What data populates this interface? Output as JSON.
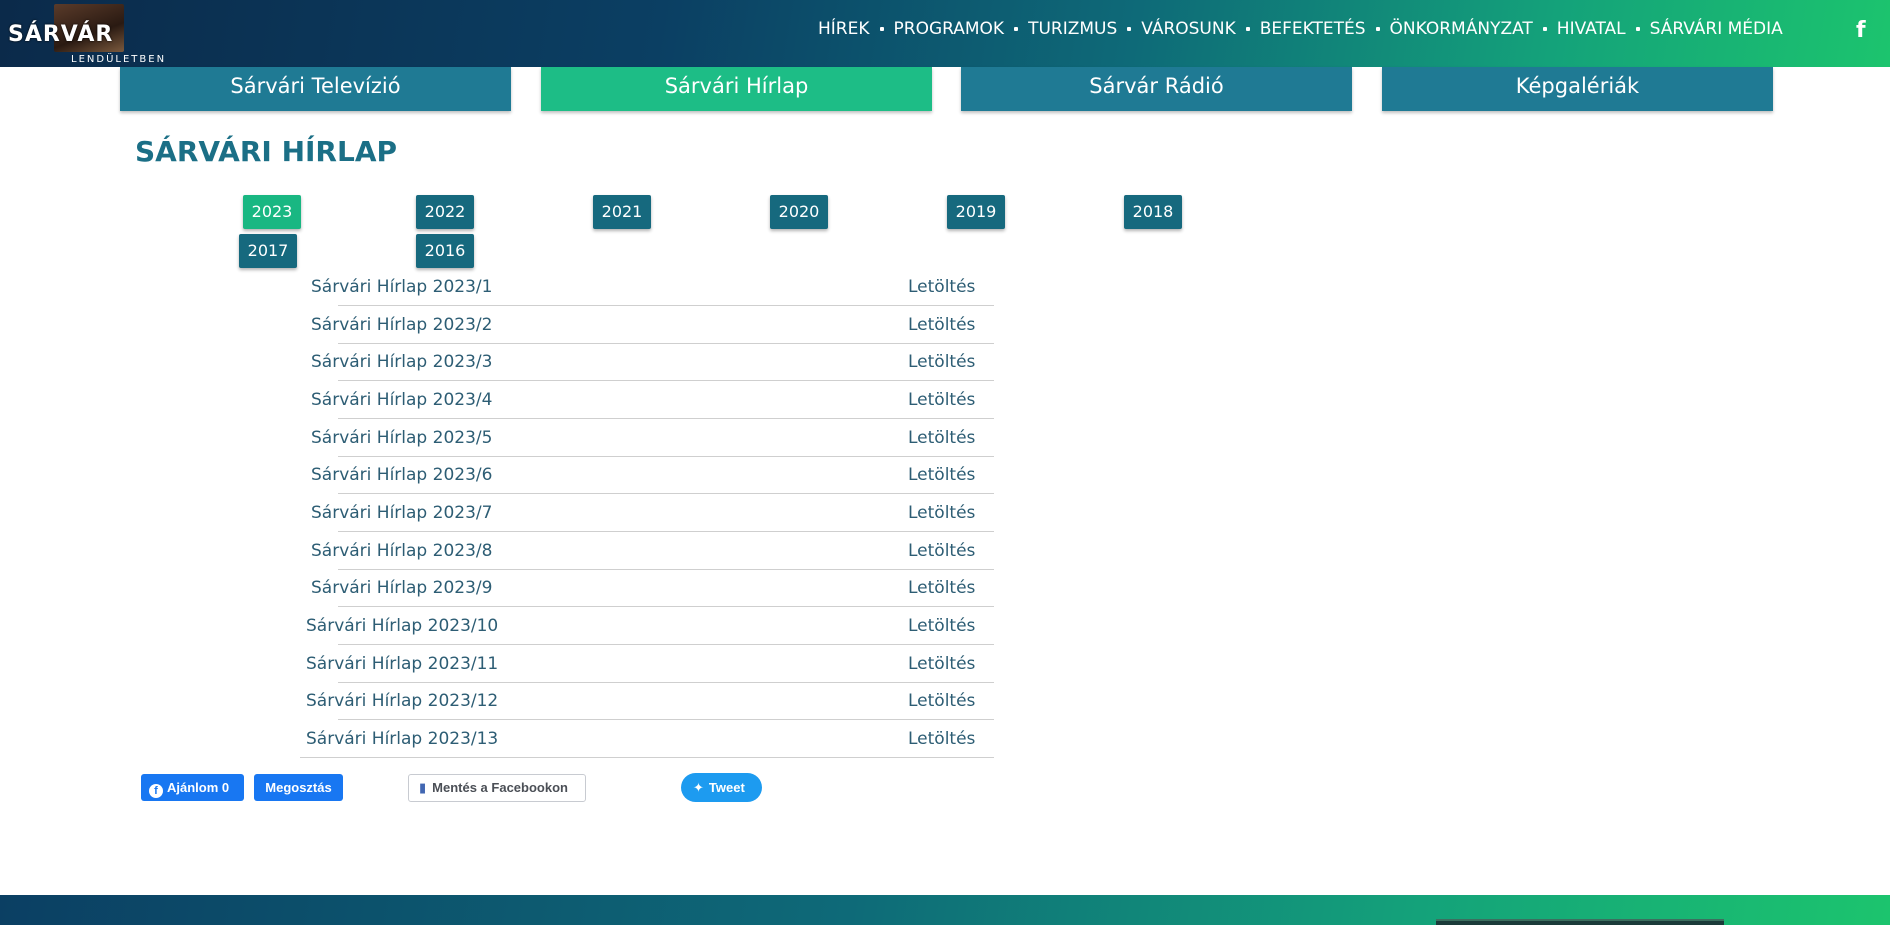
{
  "header": {
    "logo_title": "SÁRVÁR",
    "logo_subtitle": "LENDÜLETBEN",
    "nav": [
      "HÍREK",
      "PROGRAMOK",
      "TURIZMUS",
      "VÁROSUNK",
      "BEFEKTETÉS",
      "ÖNKORMÁNYZAT",
      "HIVATAL",
      "SÁRVÁRI MÉDIA"
    ],
    "facebook_icon": "f"
  },
  "media_tabs": [
    "Sárvári Televízió",
    "Sárvári Hírlap",
    "Sárvár Rádió",
    "Képgalériák"
  ],
  "media_tabs_active": "Sárvári Hírlap",
  "page_title": "SÁRVÁRI HÍRLAP",
  "years": [
    "2023",
    "2022",
    "2021",
    "2020",
    "2019",
    "2018",
    "2017",
    "2016"
  ],
  "active_year": "2023",
  "issues": [
    {
      "name": "Sárvári Hírlap 2023/1",
      "download": "Letöltés"
    },
    {
      "name": "Sárvári Hírlap 2023/2",
      "download": "Letöltés"
    },
    {
      "name": "Sárvári Hírlap 2023/3",
      "download": "Letöltés"
    },
    {
      "name": "Sárvári Hírlap 2023/4",
      "download": "Letöltés"
    },
    {
      "name": "Sárvári Hírlap 2023/5",
      "download": "Letöltés"
    },
    {
      "name": "Sárvári Hírlap 2023/6",
      "download": "Letöltés"
    },
    {
      "name": "Sárvári Hírlap 2023/7",
      "download": "Letöltés"
    },
    {
      "name": "Sárvári Hírlap 2023/8",
      "download": "Letöltés"
    },
    {
      "name": "Sárvári Hírlap 2023/9",
      "download": "Letöltés"
    },
    {
      "name": "Sárvári Hírlap 2023/10",
      "download": "Letöltés"
    },
    {
      "name": "Sárvári Hírlap 2023/11",
      "download": "Letöltés"
    },
    {
      "name": "Sárvári Hírlap 2023/12",
      "download": "Letöltés"
    },
    {
      "name": "Sárvári Hírlap 2023/13",
      "download": "Letöltés"
    }
  ],
  "social": {
    "like_label": "Ajánlom 0",
    "share_label": "Megosztás",
    "save_label": "Mentés a Facebookon",
    "tweet_label": "Tweet"
  },
  "colors": {
    "primary": "#1f7a94",
    "accent": "#1dbd86",
    "title": "#1b6f86",
    "facebook": "#1877f2",
    "twitter": "#1d9bf0"
  }
}
